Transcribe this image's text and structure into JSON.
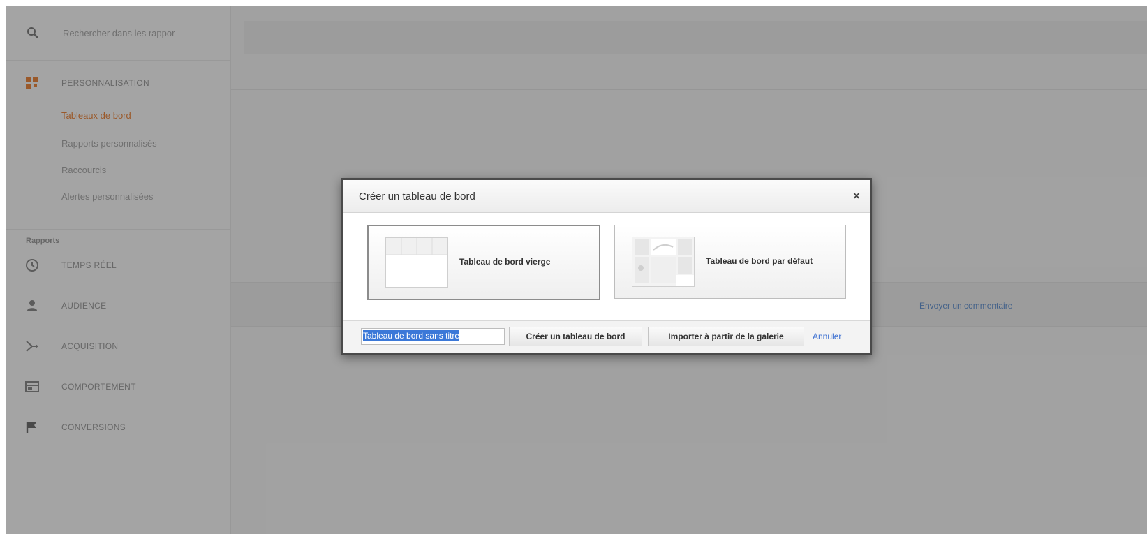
{
  "sidebar": {
    "search_placeholder": "Rechercher dans les rappor",
    "customization": {
      "label": "PERSONNALISATION",
      "items": [
        {
          "label": "Tableaux de bord",
          "active": true
        },
        {
          "label": "Rapports personnalisés",
          "active": false
        },
        {
          "label": "Raccourcis",
          "active": false
        },
        {
          "label": "Alertes personnalisées",
          "active": false
        }
      ]
    },
    "reports_heading": "Rapports",
    "reports": [
      {
        "label": "TEMPS RÉEL",
        "icon": "clock-icon"
      },
      {
        "label": "AUDIENCE",
        "icon": "person-icon"
      },
      {
        "label": "ACQUISITION",
        "icon": "acquisition-icon"
      },
      {
        "label": "COMPORTEMENT",
        "icon": "behavior-icon"
      },
      {
        "label": "CONVERSIONS",
        "icon": "flag-icon"
      }
    ]
  },
  "main": {
    "feedback_link": "Envoyer un commentaire"
  },
  "dialog": {
    "title": "Créer un tableau de bord",
    "close": "×",
    "options": {
      "blank": "Tableau de bord vierge",
      "default": "Tableau de bord par défaut"
    },
    "name_value": "Tableau de bord sans titre",
    "create_button": "Créer un tableau de bord",
    "import_button": "Importer à partir de la galerie",
    "cancel": "Annuler"
  },
  "colors": {
    "accent_orange": "#e8711c",
    "link_blue": "#3b6fd1",
    "selection_blue": "#3b78d8"
  }
}
